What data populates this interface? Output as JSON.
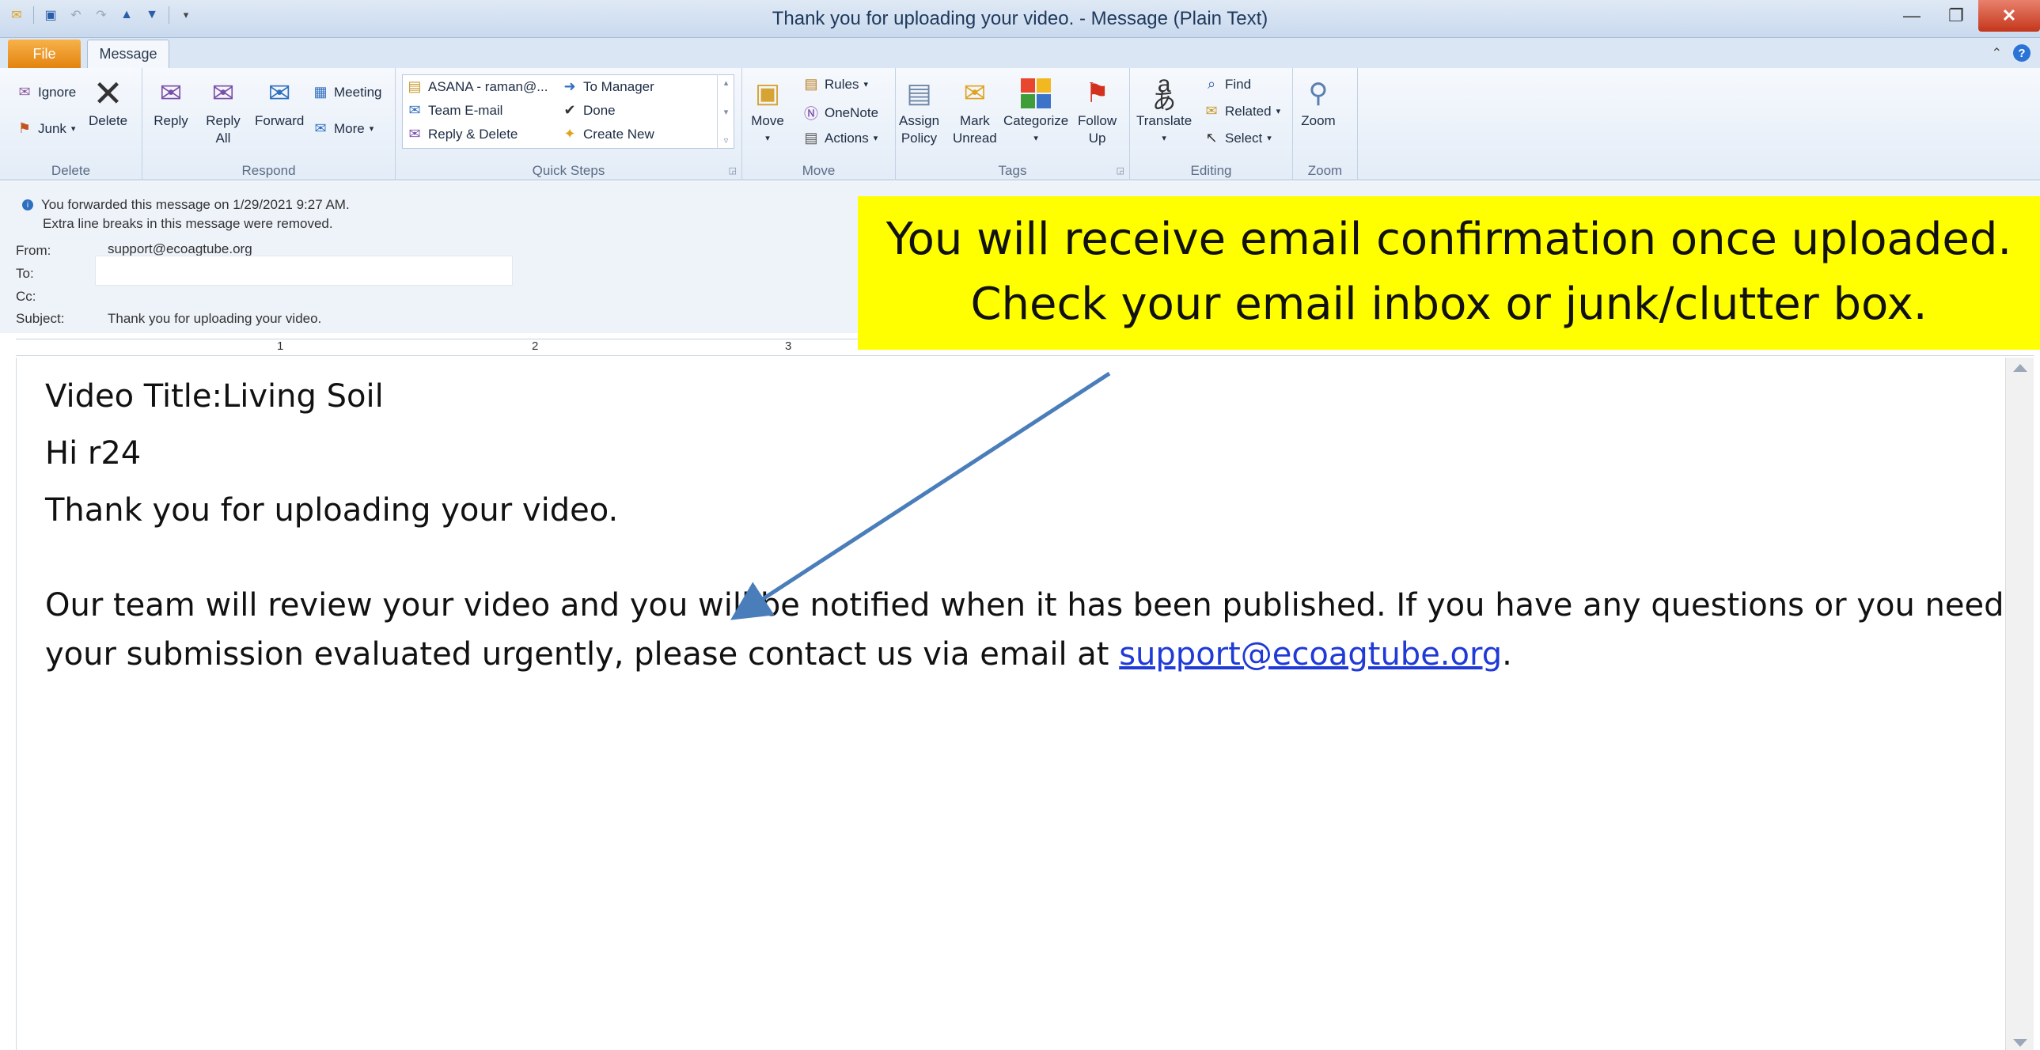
{
  "window": {
    "title": "Thank you for uploading your video.  - Message (Plain Text)",
    "close_glyph": "✕",
    "minimize_glyph": "—",
    "restore_glyph": "❐"
  },
  "tabs": {
    "file": "File",
    "message": "Message"
  },
  "ribbon": {
    "delete_group": {
      "label": "Delete",
      "ignore": "Ignore",
      "junk": "Junk",
      "delete": "Delete"
    },
    "respond_group": {
      "label": "Respond",
      "reply": "Reply",
      "reply_all_1": "Reply",
      "reply_all_2": "All",
      "forward": "Forward",
      "meeting": "Meeting",
      "more": "More"
    },
    "quick_steps_group": {
      "label": "Quick Steps",
      "asana": "ASANA - raman@...",
      "team_email": "Team E-mail",
      "reply_delete": "Reply & Delete",
      "to_manager": "To Manager",
      "done": "Done",
      "create_new": "Create New"
    },
    "move_group": {
      "label": "Move",
      "move": "Move",
      "rules": "Rules",
      "onenote": "OneNote",
      "actions": "Actions"
    },
    "tags_group": {
      "label": "Tags",
      "assign_policy_1": "Assign",
      "assign_policy_2": "Policy",
      "mark_unread_1": "Mark",
      "mark_unread_2": "Unread",
      "categorize": "Categorize",
      "follow_up_1": "Follow",
      "follow_up_2": "Up"
    },
    "editing_group": {
      "label": "Editing",
      "translate": "Translate",
      "find": "Find",
      "related": "Related",
      "select": "Select"
    },
    "zoom_group": {
      "label": "Zoom",
      "zoom": "Zoom"
    }
  },
  "header": {
    "info_forwarded": "You forwarded this message on 1/29/2021 9:27 AM.",
    "info_linebreaks": "Extra line breaks in this message were removed.",
    "from_label": "From:",
    "from_value": "support@ecoagtube.org",
    "to_label": "To:",
    "cc_label": "Cc:",
    "subject_label": "Subject:",
    "subject_value": "Thank you for uploading your video."
  },
  "ruler": {
    "marks": [
      "1",
      "2",
      "3"
    ]
  },
  "body": {
    "video_title": "Video Title:Living Soil",
    "greeting": "Hi r24",
    "thanks": "Thank you for uploading your video.",
    "para_line1": "Our team will review your video and you will be notified when it has been published. If you have any questions or you need",
    "para_line2_prefix": "your submission evaluated urgently, please contact us via email at ",
    "para_link": "support@ecoagtube.org",
    "para_line2_suffix": "."
  },
  "callout": {
    "line1": "You will receive email confirmation once uploaded.",
    "line2": "Check your email inbox or junk/clutter box.",
    "color": "#ffff00",
    "arrow_color": "#4a7ebb"
  }
}
